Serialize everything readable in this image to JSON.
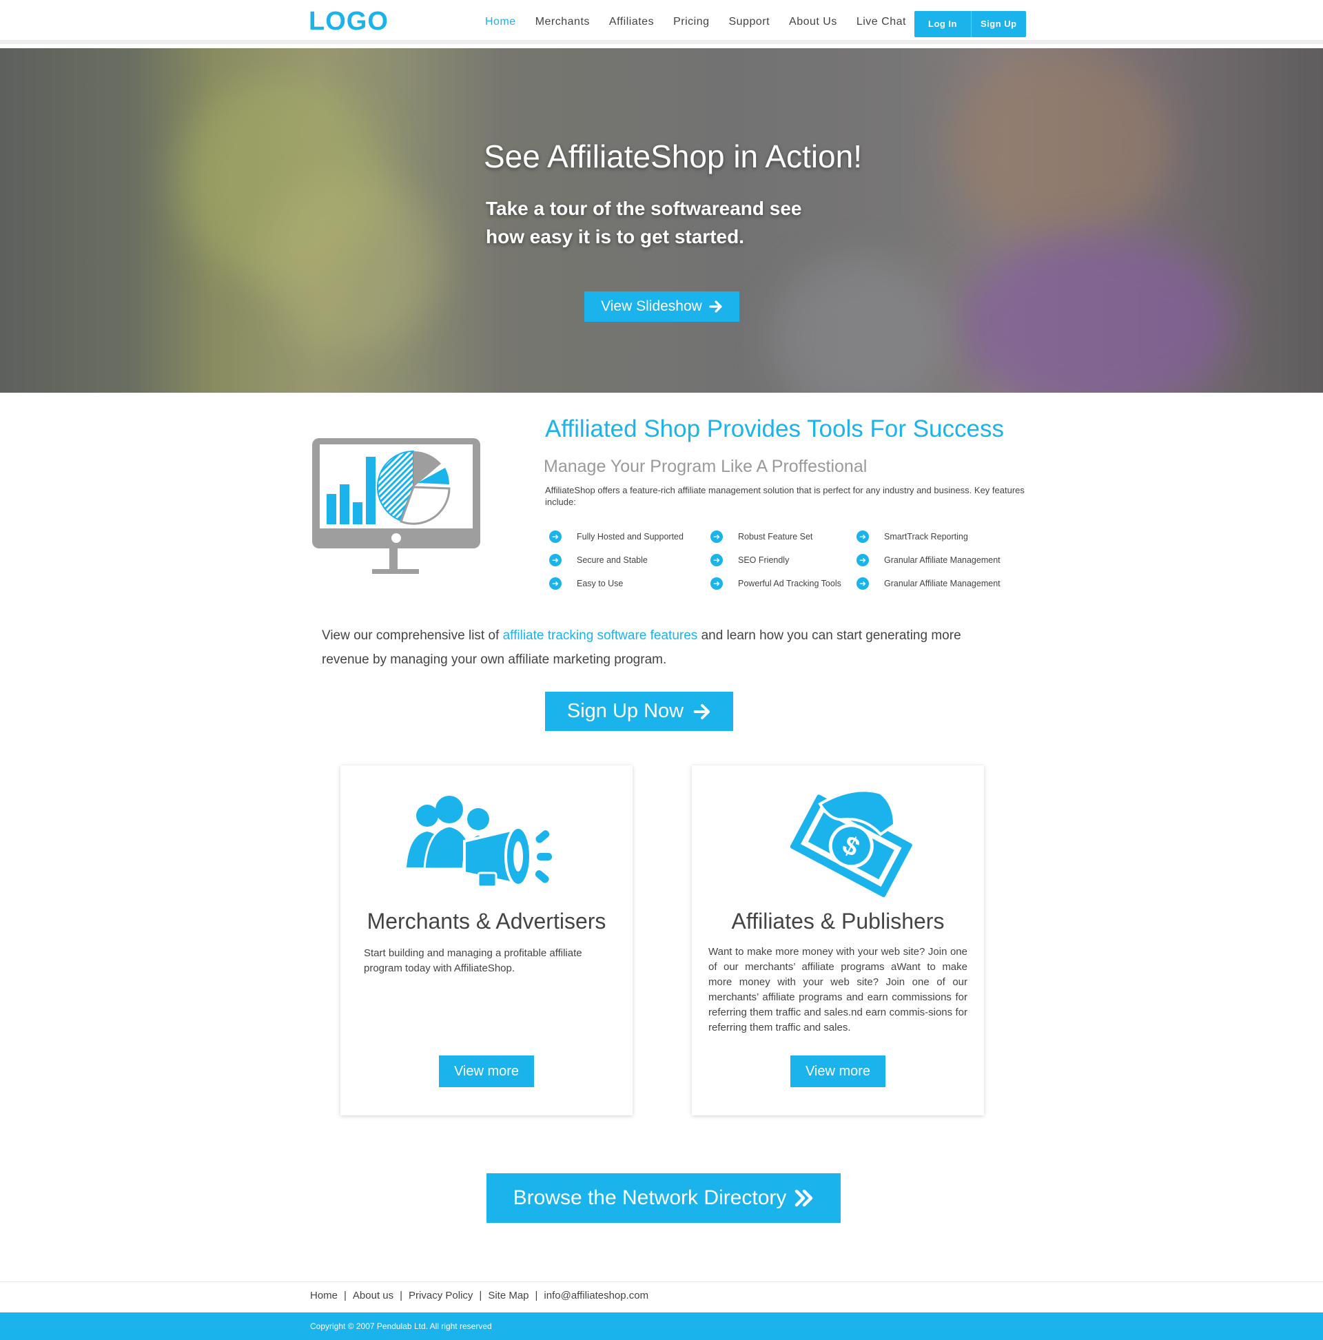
{
  "header": {
    "logo": "LOGO",
    "nav": [
      {
        "label": "Home",
        "active": true
      },
      {
        "label": "Merchants"
      },
      {
        "label": "Affiliates"
      },
      {
        "label": "Pricing"
      },
      {
        "label": "Support"
      },
      {
        "label": "About Us"
      },
      {
        "label": "Live Chat"
      }
    ],
    "login": "Log In",
    "signup": "Sign Up"
  },
  "hero": {
    "title": "See AffiliateShop in Action!",
    "subtitle": "Take a tour of the softwareand see how easy it is to get started.",
    "button": "View Slideshow"
  },
  "tools": {
    "title": "Affiliated Shop Provides Tools For Success",
    "subtitle": "Manage Your Program Like A Proffestional",
    "description": "AffiliateShop offers a feature-rich affiliate  management solution that is perfect for any industry and business. Key features include:",
    "features": [
      "Fully Hosted and Supported",
      "Secure and Stable",
      "Easy to Use",
      "Robust Feature Set",
      "SEO Friendly",
      "Powerful Ad Tracking Tools",
      "SmartTrack Reporting",
      "Granular Affiliate Management",
      "Granular Affiliate Management"
    ]
  },
  "lead": {
    "before": "View our comprehensive list of ",
    "link": "affiliate tracking software features",
    "after": " and learn how you can start generating more revenue by managing your own affiliate marketing program."
  },
  "signup_now": "Sign Up Now",
  "cards": {
    "merchants": {
      "title": "Merchants & Advertisers",
      "text": "Start building and managing a profitable affiliate program today with AffiliateShop.",
      "button": "View more"
    },
    "affiliates": {
      "title": "Affiliates & Publishers",
      "text": "Want to make more money with your web site? Join one of our merchants’ affiliate programs aWant to make more money with your web site? Join one of our merchants’ affiliate programs and earn commissions for referring them traffic and sales.nd earn commis-sions for referring them traffic and sales.",
      "button": "View more"
    }
  },
  "browse": "Browse the Network Directory",
  "footer": {
    "links": [
      "Home",
      "About us",
      "Privacy Policy",
      "Site Map",
      "info@affiliateshop.com"
    ],
    "copyright": "Copyright © 2007 Pendulab Ltd. All right reserved"
  },
  "colors": {
    "accent": "#1ab3ec",
    "text": "#444444",
    "muted": "#9a9a9a"
  },
  "icons": [
    "arrow-right-icon",
    "monitor-chart-icon",
    "megaphone-people-icon",
    "money-hand-icon",
    "double-chevron-icon"
  ]
}
